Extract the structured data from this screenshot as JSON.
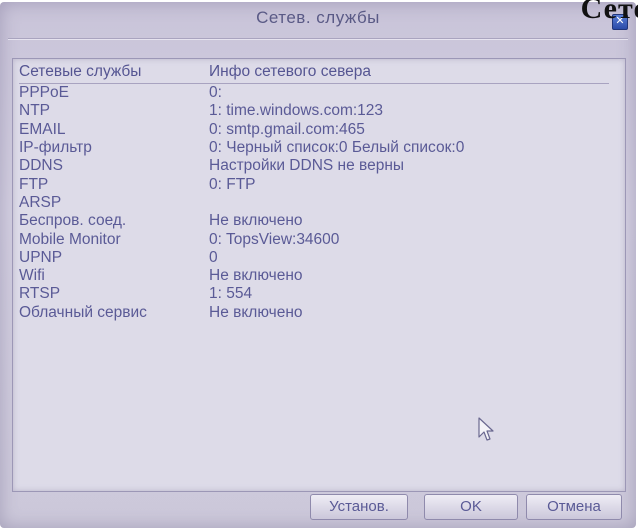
{
  "corner_text": "Сете",
  "window": {
    "title": "Сетев. службы",
    "close_icon": "close-icon"
  },
  "table": {
    "headers": [
      "Сетевые службы",
      "Инфо сетевого севера"
    ],
    "rows": [
      {
        "name": "PPPoE",
        "info": "0:"
      },
      {
        "name": "NTP",
        "info": "1: time.windows.com:123"
      },
      {
        "name": "EMAIL",
        "info": "0: smtp.gmail.com:465"
      },
      {
        "name": "IP-фильтр",
        "info": "0: Черный список:0 Белый список:0"
      },
      {
        "name": "DDNS",
        "info": "Настройки DDNS не верны"
      },
      {
        "name": "FTP",
        "info": "0: FTP"
      },
      {
        "name": "ARSP",
        "info": ""
      },
      {
        "name": "Беспров. соед.",
        "info": "Не включено"
      },
      {
        "name": "Mobile Monitor",
        "info": "0: TopsView:34600"
      },
      {
        "name": "UPNP",
        "info": "0"
      },
      {
        "name": "Wifi",
        "info": "Не включено"
      },
      {
        "name": "RTSP",
        "info": "1: 554"
      },
      {
        "name": "Облачный сервис",
        "info": "Не включено"
      }
    ]
  },
  "buttons": {
    "apply": "Установ.",
    "ok": "OK",
    "cancel": "Отмена"
  }
}
